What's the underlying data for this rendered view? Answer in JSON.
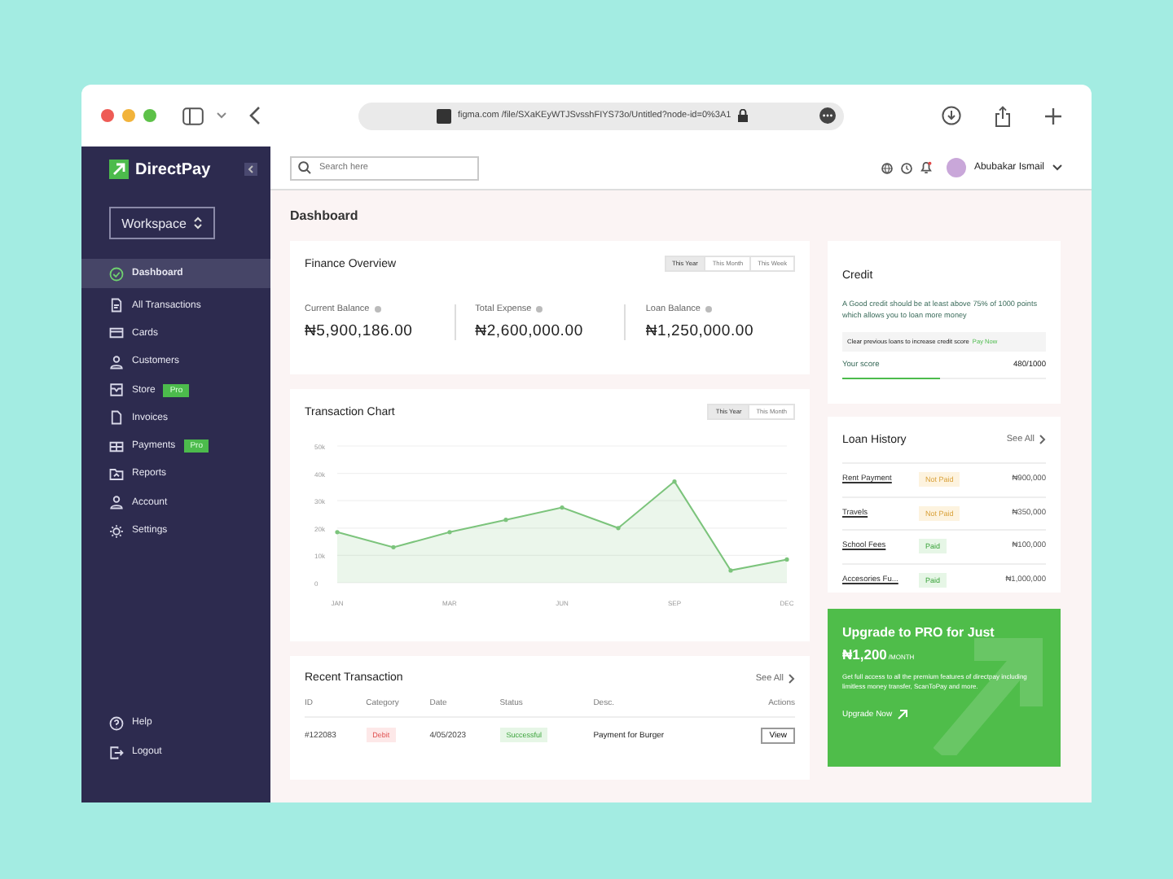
{
  "browser": {
    "url": "figma.com /file/SXaKEyWTJSvsshFIYS73o/Untitled?node-id=0%3A1"
  },
  "sidebar": {
    "logo": "DirectPay",
    "workspace": "Workspace",
    "items": [
      {
        "label": "Dashboard",
        "selected": true
      },
      {
        "label": "All Transactions",
        "selected": false
      },
      {
        "label": "Cards",
        "selected": false
      },
      {
        "label": "Customers",
        "selected": false
      },
      {
        "label": "Store",
        "selected": false,
        "badge": "Pro"
      },
      {
        "label": "Invoices",
        "selected": false
      },
      {
        "label": "Payments",
        "selected": false,
        "badge": "Pro"
      },
      {
        "label": "Reports",
        "selected": false
      },
      {
        "label": "Account",
        "selected": false
      },
      {
        "label": "Settings",
        "selected": false
      }
    ],
    "footer": [
      {
        "label": "Help"
      },
      {
        "label": "Logout"
      }
    ]
  },
  "topbar": {
    "search": {
      "placeholder": "Search here"
    },
    "user": "Abubakar Ismail"
  },
  "page_title": "Dashboard",
  "finance": {
    "title": "Finance Overview",
    "tabs": [
      {
        "label": "This Year",
        "selected": true
      },
      {
        "label": "This Month",
        "selected": false
      },
      {
        "label": "This Week",
        "selected": false
      }
    ],
    "stats": [
      {
        "label": "Current Balance",
        "value": "₦5,900,186.00"
      },
      {
        "label": "Total Expense",
        "value": "₦2,600,000.00"
      },
      {
        "label": "Loan Balance",
        "value": "₦1,250,000.00"
      }
    ]
  },
  "transaction_chart": {
    "title": "Transaction Chart",
    "tabs": [
      {
        "label": "This Year",
        "selected": true
      },
      {
        "label": "This Month",
        "selected": false
      }
    ],
    "chart_data": {
      "type": "area",
      "categories": [
        "JAN",
        null,
        "MAR",
        null,
        "JUN",
        null,
        "SEP",
        null,
        "DEC"
      ],
      "series": [
        {
          "color": "#7cc47c",
          "values": [
            18500,
            13000,
            18500,
            23000,
            27500,
            20000,
            37000,
            4500,
            8500
          ]
        }
      ],
      "ylim": [
        0,
        50000
      ],
      "grid": true,
      "yticks": [
        {
          "value": 0,
          "label": "0"
        },
        {
          "value": 10000,
          "label": "10k"
        },
        {
          "value": 20000,
          "label": "20k"
        },
        {
          "value": 30000,
          "label": "30k"
        },
        {
          "value": 40000,
          "label": "40k"
        },
        {
          "value": 50000,
          "label": "50k"
        }
      ]
    }
  },
  "recent": {
    "title": "Recent Transaction",
    "see_all": "See All",
    "columns": [
      "ID",
      "Category",
      "Date",
      "Status",
      "Desc.",
      "Actions"
    ],
    "rows": [
      {
        "id": "#122083",
        "category": "Debit",
        "date": "4/05/2023",
        "status": "Successful",
        "desc": "Payment for Burger",
        "action": "View"
      }
    ]
  },
  "credit": {
    "title": "Credit",
    "text": "A Good credit should be at least above 75% of 1000 points which allows you to loan more money",
    "notice": "Clear previous loans to increase credit score",
    "notice_link": "Pay Now",
    "score_label": "Your score",
    "score": "480/1000",
    "level": 0.48
  },
  "loans": {
    "title": "Loan History",
    "see_all": "See All",
    "items": [
      {
        "name": "Rent Payment",
        "status": "Not Paid",
        "paid": false,
        "amount": "₦900,000"
      },
      {
        "name": "Travels",
        "status": "Not Paid",
        "paid": false,
        "amount": "₦350,000"
      },
      {
        "name": "School Fees",
        "status": "Paid",
        "paid": true,
        "amount": "₦100,000"
      },
      {
        "name": "Accesories Fu...",
        "status": "Paid",
        "paid": true,
        "amount": "₦1,000,000"
      }
    ]
  },
  "upgrade": {
    "title": "Upgrade to PRO for Just",
    "price": "₦1,200",
    "per": "/MONTH",
    "text": "Get full access to all the premium features of directpay including limitless money transfer, ScanToPay and more.",
    "cta": "Upgrade Now"
  }
}
